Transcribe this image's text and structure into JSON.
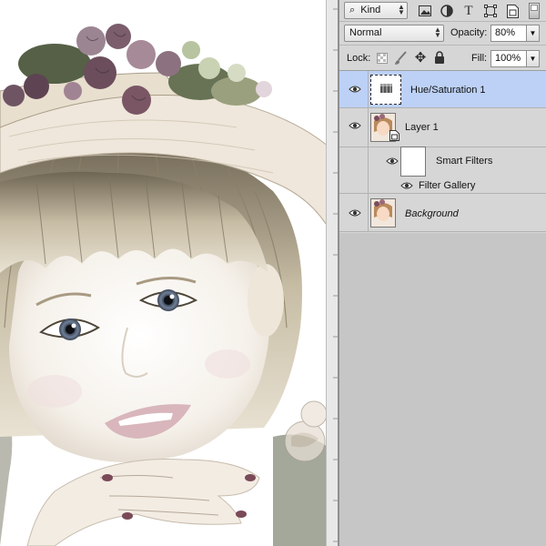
{
  "layers_panel": {
    "filter": {
      "kind_label": "Kind",
      "search_icon": "search-icon",
      "filter_icons": [
        "image-filter-icon",
        "adjustment-filter-icon",
        "type-filter-icon",
        "shape-filter-icon",
        "smart-object-filter-icon"
      ]
    },
    "blend_mode": "Normal",
    "opacity_label": "Opacity:",
    "opacity_value": "80%",
    "lock_label": "Lock:",
    "lock_icons": [
      "lock-transparent-icon",
      "lock-image-icon",
      "lock-position-icon",
      "lock-all-icon"
    ],
    "fill_label": "Fill:",
    "fill_value": "100%",
    "layers": [
      {
        "name": "Hue/Saturation 1",
        "selected": true,
        "visible": true
      },
      {
        "name": "Layer 1",
        "selected": false,
        "visible": true
      },
      {
        "name": "Smart Filters",
        "selected": false,
        "visible": true
      },
      {
        "name": "Filter Gallery",
        "selected": false,
        "visible": true
      },
      {
        "name": "Background",
        "selected": false,
        "visible": true
      }
    ]
  },
  "colors": {
    "selected_row": "#bcd1f5",
    "panel_bg": "#d6d6d6",
    "empty_area": "#c6c6c6"
  }
}
